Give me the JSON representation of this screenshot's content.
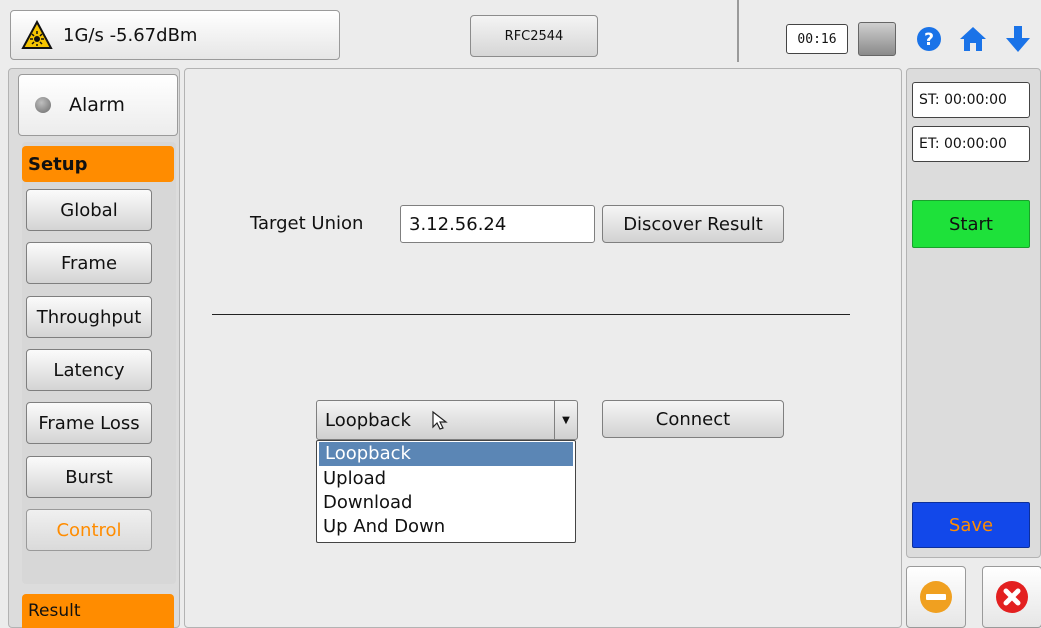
{
  "status": {
    "text": "1G/s -5.67dBm",
    "icon": "laser-warning-icon",
    "accent": "#f5c400"
  },
  "header": {
    "mode_label": "RFC2544",
    "timer": "00:16"
  },
  "sidebar": {
    "alarm_label": "Alarm",
    "setup_label": "Setup",
    "items": [
      {
        "label": "Global"
      },
      {
        "label": "Frame"
      },
      {
        "label": "Throughput"
      },
      {
        "label": "Latency"
      },
      {
        "label": "Frame Loss"
      },
      {
        "label": "Burst"
      },
      {
        "label": "Control"
      }
    ],
    "result_label": "Result"
  },
  "main": {
    "target_label": "Target Union",
    "target_value": "3.12.56.24",
    "discover_label": "Discover Result",
    "mode_select": {
      "selected": "Loopback",
      "options": [
        "Loopback",
        "Upload",
        "Download",
        "Up And Down"
      ]
    },
    "connect_label": "Connect"
  },
  "right": {
    "st_label": "ST: 00:00:00",
    "et_label": "ET: 00:00:00",
    "start_label": "Start",
    "save_label": "Save"
  },
  "colors": {
    "orange": "#ff8c00",
    "green": "#1ee13a",
    "blue": "#1248ea",
    "highlight": "#5b86b5"
  }
}
